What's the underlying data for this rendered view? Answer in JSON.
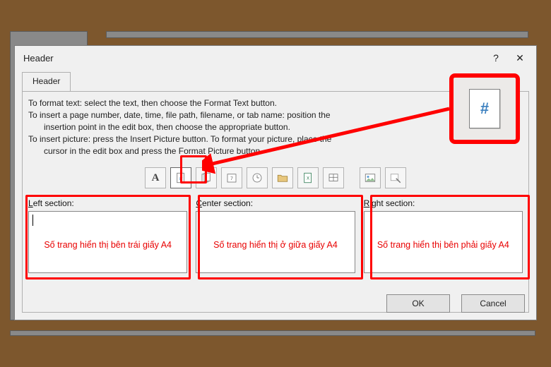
{
  "dialog": {
    "title": "Header",
    "help": "?",
    "close": "✕",
    "tab_label": "Header",
    "instructions": {
      "l1a": "To format text:  select the text, then choose the Format Text button.",
      "l2a": "To insert a page number, date, time, file path, filename, or tab name:  position the",
      "l2b": "insertion point in the edit box, then choose the appropriate button.",
      "l3a": "To insert picture: press the Insert Picture button.  To format your picture, place the",
      "l3b": "cursor in the edit box and press the Format Picture button."
    },
    "toolbar": {
      "format_text": "A",
      "page_number": "#",
      "pages": "pages",
      "date": "date",
      "time": "time",
      "file_path": "path",
      "file_name": "xl",
      "sheet_name": "sheet",
      "insert_pic": "pic",
      "format_pic": "fmtpic"
    },
    "sections": {
      "left_label_u": "L",
      "left_label_rest": "eft section:",
      "center_label_u": "C",
      "center_label_rest": "enter section:",
      "right_label_u": "R",
      "right_label_rest": "ight section:"
    },
    "buttons": {
      "ok": "OK",
      "cancel": "Cancel"
    }
  },
  "annotations": {
    "left": "Số trang hiển thị bên trái giấy A4",
    "center": "Số trang hiển thị ở giữa giấy A4",
    "right": "Số trang hiển thị bên phải giấy A4"
  }
}
